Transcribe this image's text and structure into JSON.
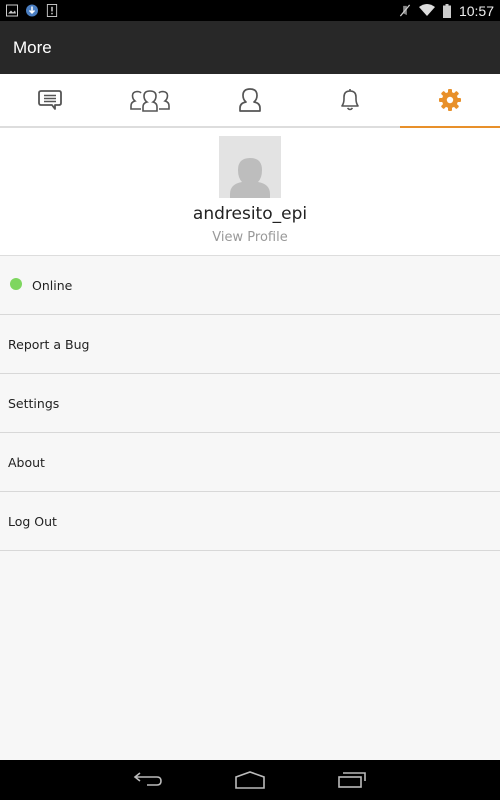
{
  "status_bar": {
    "left_icons": [
      "image-icon",
      "download-icon",
      "alert-icon"
    ],
    "right_icons": [
      "mute-icon",
      "wifi-icon",
      "battery-icon"
    ],
    "time": "10:57"
  },
  "app_bar": {
    "title": "More"
  },
  "tabs": [
    {
      "name": "messages",
      "icon": "chat-icon",
      "active": false
    },
    {
      "name": "groups",
      "icon": "group-icon",
      "active": false
    },
    {
      "name": "contacts",
      "icon": "person-icon",
      "active": false
    },
    {
      "name": "notifications",
      "icon": "bell-icon",
      "active": false
    },
    {
      "name": "more",
      "icon": "gear-icon",
      "active": true
    }
  ],
  "profile": {
    "username": "andresito_epi",
    "view_profile_label": "View Profile"
  },
  "menu": {
    "status": {
      "label": "Online",
      "color": "#7ed65f"
    },
    "items": [
      {
        "label": "Report a Bug"
      },
      {
        "label": "Settings"
      },
      {
        "label": "About"
      },
      {
        "label": "Log Out"
      }
    ]
  },
  "colors": {
    "accent": "#e8902a",
    "appbar": "#282828"
  }
}
